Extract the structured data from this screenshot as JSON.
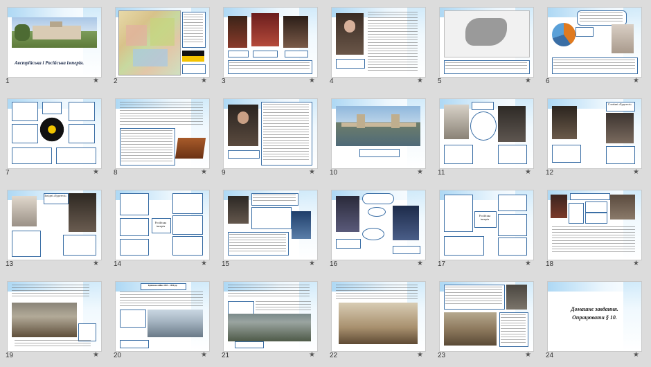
{
  "slides": [
    {
      "number": "1",
      "title": "Австрійська і Російська імперія."
    },
    {
      "number": "2"
    },
    {
      "number": "3"
    },
    {
      "number": "4"
    },
    {
      "number": "5"
    },
    {
      "number": "6"
    },
    {
      "number": "7"
    },
    {
      "number": "8"
    },
    {
      "number": "9"
    },
    {
      "number": "10"
    },
    {
      "number": "11"
    },
    {
      "number": "12",
      "label": "Слов'яні «Будителі»"
    },
    {
      "number": "13",
      "label": "Західні «Будителі»"
    },
    {
      "number": "14",
      "label": "Російська імперія"
    },
    {
      "number": "15"
    },
    {
      "number": "16"
    },
    {
      "number": "17",
      "label": "Російська імперія"
    },
    {
      "number": "18"
    },
    {
      "number": "19"
    },
    {
      "number": "20",
      "label": "Кримська війна 1853 – 1856 рр."
    },
    {
      "number": "21"
    },
    {
      "number": "22"
    },
    {
      "number": "23"
    },
    {
      "number": "24",
      "title": "Домашнє завдання.",
      "subtitle": "Опрацювати § 10."
    }
  ],
  "star_icon": "★",
  "colors": {
    "accent": "#3a6ea5",
    "header_gradient": "#9fd1f2",
    "background": "#dcdcdc"
  }
}
